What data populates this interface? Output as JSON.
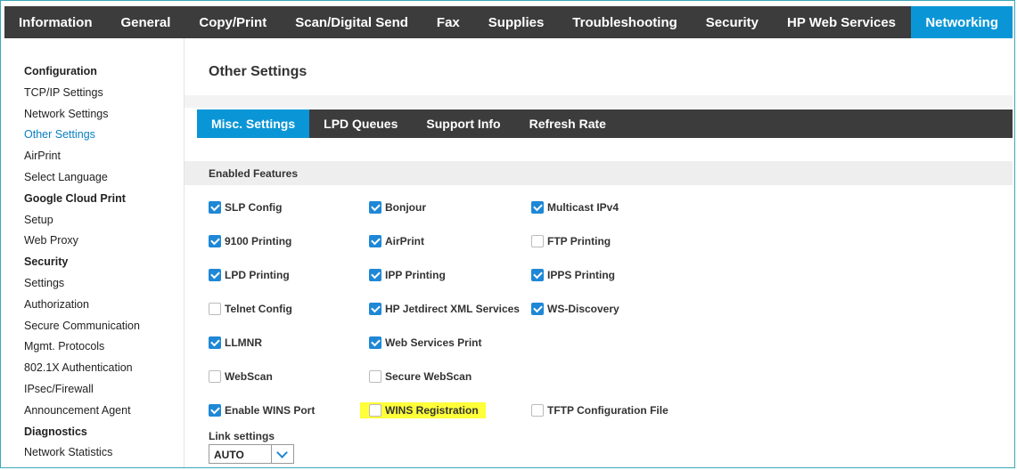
{
  "topnav": {
    "tabs": [
      "Information",
      "General",
      "Copy/Print",
      "Scan/Digital Send",
      "Fax",
      "Supplies",
      "Troubleshooting",
      "Security",
      "HP Web Services"
    ],
    "active": "Networking"
  },
  "sidebar": {
    "items": [
      {
        "label": "Configuration",
        "type": "head"
      },
      {
        "label": "TCP/IP Settings",
        "type": "link"
      },
      {
        "label": "Network Settings",
        "type": "link"
      },
      {
        "label": "Other Settings",
        "type": "link",
        "active": true
      },
      {
        "label": "AirPrint",
        "type": "link"
      },
      {
        "label": "Select Language",
        "type": "link"
      },
      {
        "label": "Google Cloud Print",
        "type": "head"
      },
      {
        "label": "Setup",
        "type": "link"
      },
      {
        "label": "Web Proxy",
        "type": "link"
      },
      {
        "label": "Security",
        "type": "head"
      },
      {
        "label": "Settings",
        "type": "link"
      },
      {
        "label": "Authorization",
        "type": "link"
      },
      {
        "label": "Secure Communication",
        "type": "link"
      },
      {
        "label": "Mgmt. Protocols",
        "type": "link"
      },
      {
        "label": "802.1X Authentication",
        "type": "link"
      },
      {
        "label": "IPsec/Firewall",
        "type": "link"
      },
      {
        "label": "Announcement Agent",
        "type": "link"
      },
      {
        "label": "Diagnostics",
        "type": "head"
      },
      {
        "label": "Network Statistics",
        "type": "link"
      }
    ]
  },
  "main": {
    "title": "Other Settings",
    "subtabs": [
      "Misc. Settings",
      "LPD Queues",
      "Support Info",
      "Refresh Rate"
    ],
    "section_title": "Enabled Features",
    "features": [
      [
        {
          "label": "SLP Config",
          "checked": true
        },
        {
          "label": "9100 Printing",
          "checked": true
        },
        {
          "label": "LPD Printing",
          "checked": true
        },
        {
          "label": "Telnet Config",
          "checked": false
        },
        {
          "label": "LLMNR",
          "checked": true
        },
        {
          "label": "WebScan",
          "checked": false
        },
        {
          "label": "Enable WINS Port",
          "checked": true
        }
      ],
      [
        {
          "label": "Bonjour",
          "checked": true
        },
        {
          "label": "AirPrint",
          "checked": true
        },
        {
          "label": "IPP Printing",
          "checked": true
        },
        {
          "label": "HP Jetdirect XML Services",
          "checked": true
        },
        {
          "label": "Web Services Print",
          "checked": true
        },
        {
          "label": "Secure WebScan",
          "checked": false
        },
        {
          "label": "WINS Registration",
          "checked": false,
          "highlighted": true
        }
      ],
      [
        {
          "label": "Multicast IPv4",
          "checked": true
        },
        {
          "label": "FTP Printing",
          "checked": false
        },
        {
          "label": "IPPS Printing",
          "checked": true
        },
        {
          "label": "WS-Discovery",
          "checked": true
        },
        null,
        null,
        {
          "label": "TFTP Configuration File",
          "checked": false
        }
      ]
    ],
    "link_settings_label": "Link settings",
    "link_settings_value": "AUTO"
  },
  "colors": {
    "nav_bg": "#3c3c3c",
    "accent": "#0a96d6",
    "checkbox_on": "#1e88d6",
    "highlight": "#ffff3a",
    "frame_border": "#3aa9b5"
  }
}
